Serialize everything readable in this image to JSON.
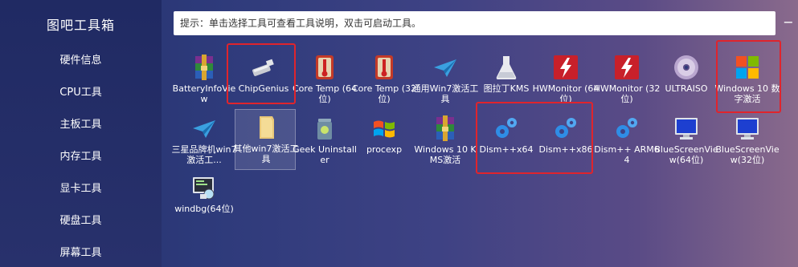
{
  "app": {
    "title": "图吧工具箱"
  },
  "sidebar": {
    "items": [
      {
        "label": "硬件信息"
      },
      {
        "label": "CPU工具"
      },
      {
        "label": "主板工具"
      },
      {
        "label": "内存工具"
      },
      {
        "label": "显卡工具"
      },
      {
        "label": "硬盘工具"
      },
      {
        "label": "屏幕工具"
      }
    ]
  },
  "hint": {
    "text": "提示：单击选择工具可查看工具说明，双击可启动工具。"
  },
  "window": {
    "close_label": "−"
  },
  "tools": [
    {
      "label": "BatteryInfoView",
      "icon": "winrar-archive-icon"
    },
    {
      "label": "ChipGenius",
      "icon": "usb-drive-icon"
    },
    {
      "label": "Core Temp (64位)",
      "icon": "thermometer-icon"
    },
    {
      "label": "Core Temp (32位)",
      "icon": "thermometer-icon"
    },
    {
      "label": "通用Win7激活工具",
      "icon": "paper-plane-icon"
    },
    {
      "label": "图拉丁KMS",
      "icon": "flask-icon"
    },
    {
      "label": "HWMonitor (64位)",
      "icon": "hwmonitor-icon"
    },
    {
      "label": "HWMonitor (32位)",
      "icon": "hwmonitor-icon"
    },
    {
      "label": "ULTRAISO",
      "icon": "disc-icon"
    },
    {
      "label": "Windows 10 数字激活",
      "icon": "windows-logo-icon"
    },
    {
      "label": "三星品牌机win7激活工...",
      "icon": "paper-plane-icon"
    },
    {
      "label": "其他win7激活工具",
      "icon": "folder-icon"
    },
    {
      "label": "Geek Uninstaller",
      "icon": "trash-can-icon"
    },
    {
      "label": "procexp",
      "icon": "windows-flag-icon"
    },
    {
      "label": "Windows 10 KMS激活",
      "icon": "winrar-archive-icon"
    },
    {
      "label": "Dism++x64",
      "icon": "gears-icon"
    },
    {
      "label": "Dism++x86",
      "icon": "gears-icon"
    },
    {
      "label": "Dism++ ARM64",
      "icon": "gears-icon"
    },
    {
      "label": "BlueScreenView(64位)",
      "icon": "monitor-icon"
    },
    {
      "label": "BlueScreenView(32位)",
      "icon": "monitor-icon"
    },
    {
      "label": "windbg(64位)",
      "icon": "debugger-monitor-icon"
    }
  ],
  "colors": {
    "highlight": "#e0242c",
    "sidebar_bg": "#202a63",
    "text": "#ffffff"
  }
}
